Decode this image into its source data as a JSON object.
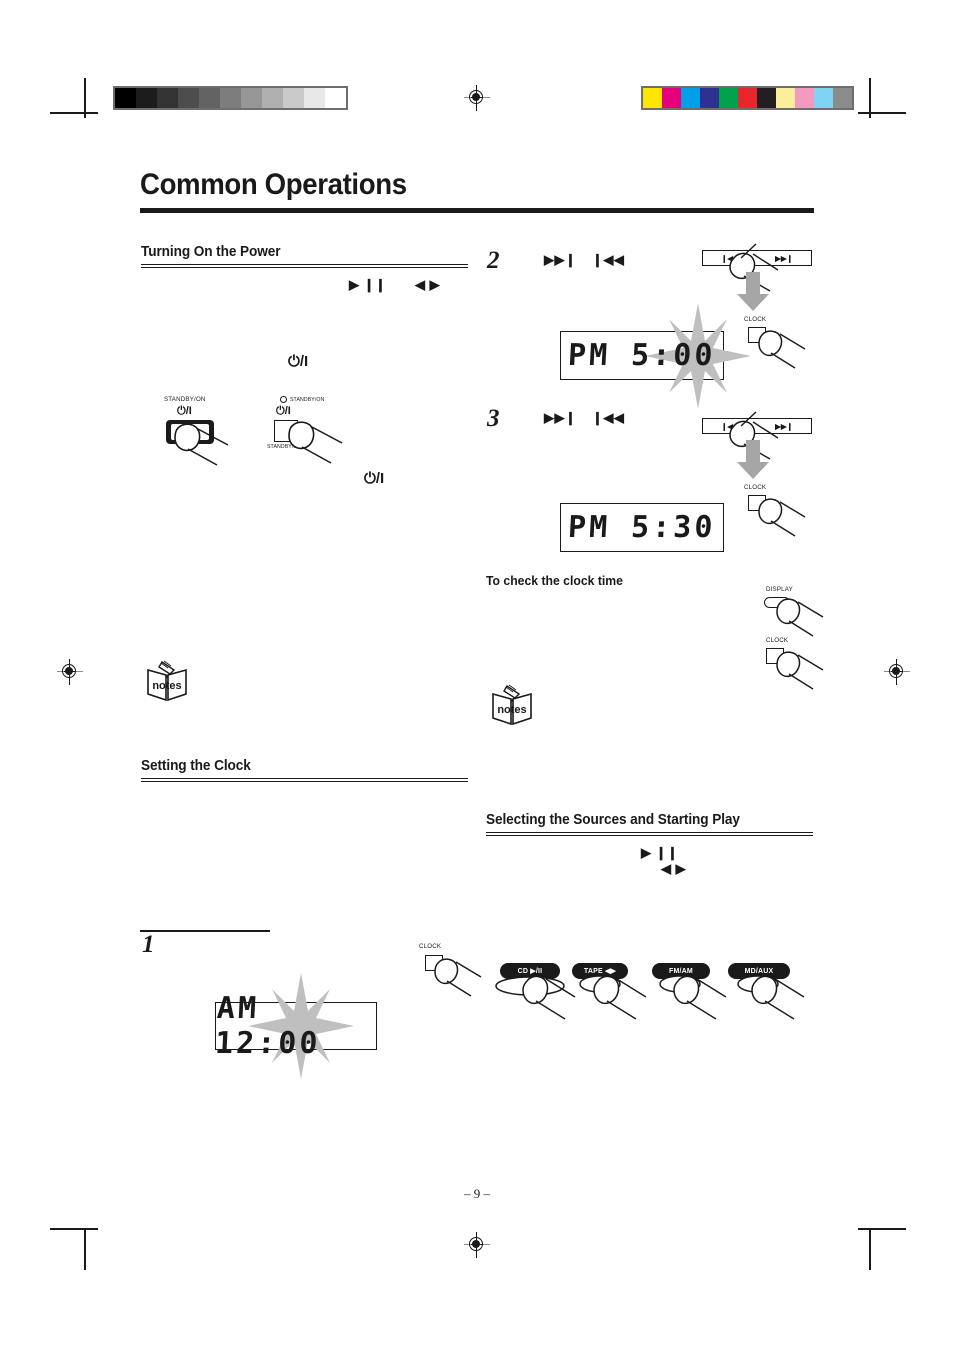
{
  "page": {
    "title": "Common Operations",
    "page_number": "– 9 –"
  },
  "print_marks": {
    "grayscale_swatches": [
      "#000000",
      "#1c1c1c",
      "#333333",
      "#4d4d4d",
      "#636363",
      "#7d7d7d",
      "#969696",
      "#b0b0b0",
      "#cacaca",
      "#e8e8e8",
      "#ffffff"
    ],
    "color_swatches": [
      "#ffe600",
      "#e5007e",
      "#00a0e9",
      "#2e3192",
      "#00a14b",
      "#e8262b",
      "#231f20",
      "#fcee9b",
      "#f49ac1",
      "#7ed4f2",
      "#8c8c8c"
    ]
  },
  "left_column": {
    "section_power": {
      "heading": "Turning On the Power",
      "glyph_playpause": "▶ ❙❙",
      "glyph_leftright": "◀ ▶",
      "power_symbol": "⏻/I",
      "power_symbol_standalone": "⏻/I",
      "unit_button": {
        "label_top": "STANDBY/ON",
        "symbol": "⏻/I",
        "name": "standby-on-unit"
      },
      "remote_button": {
        "indicator_label": "STANDBY/ON",
        "symbol": "⏻/I",
        "label_bottom": "STANDBY/ON",
        "name": "standby-on-remote"
      },
      "notes_icon": "notes"
    },
    "section_clock": {
      "heading": "Setting the Clock",
      "step_1": "1",
      "display": "AM 12:00"
    }
  },
  "right_column": {
    "step_2": {
      "number": "2",
      "glyph_forward": "▶▶❙",
      "glyph_back": "❙◀◀",
      "rocker_left": "❙◀◀",
      "rocker_right": "▶▶❙",
      "clock_button_label": "CLOCK",
      "display": "PM 5:00"
    },
    "step_3": {
      "number": "3",
      "glyph_forward": "▶▶❙",
      "glyph_back": "❙◀◀",
      "rocker_left": "❙◀◀",
      "rocker_right": "▶▶❙",
      "clock_button_label": "CLOCK",
      "display": "PM 5:30"
    },
    "check_clock": {
      "heading": "To check the clock time",
      "display_button_label": "DISPLAY",
      "clock_button_label": "CLOCK",
      "notes_icon": "notes"
    },
    "section_sources": {
      "heading": "Selecting the Sources and Starting Play",
      "glyph_playpause": "▶ ❙❙",
      "glyph_leftright": "◀ ▶",
      "clock_button_label": "CLOCK",
      "source_buttons": [
        {
          "label": "CD ▶/II",
          "name": "cd-play-pause-button"
        },
        {
          "label": "TAPE ◀▶",
          "name": "tape-button"
        },
        {
          "label": "FM/AM",
          "name": "fm-am-button"
        },
        {
          "label": "MD/AUX",
          "name": "md-aux-button"
        }
      ]
    }
  }
}
